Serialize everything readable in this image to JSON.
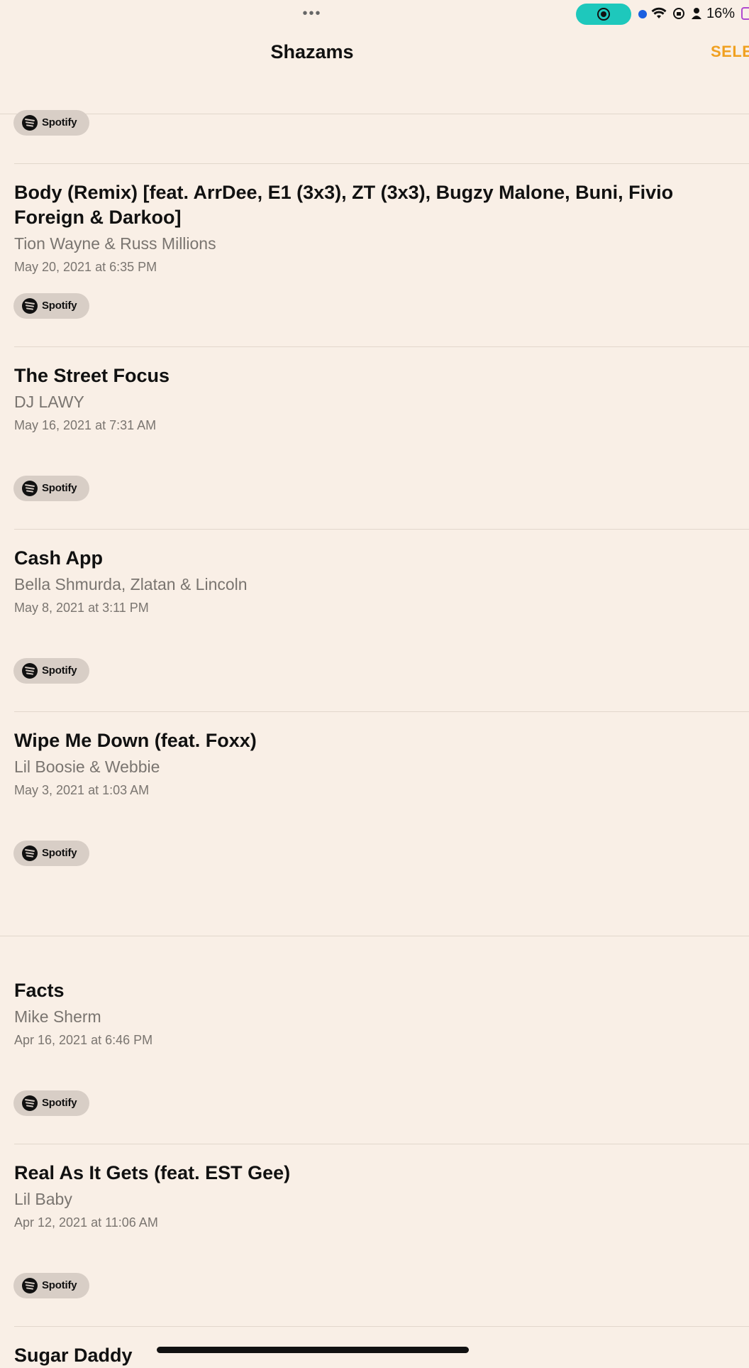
{
  "status_bar": {
    "dots": "•••",
    "battery": "16%"
  },
  "nav": {
    "title": "Shazams",
    "select": "SELE"
  },
  "songs": [
    {
      "title": "Body (Remix) [feat. ArrDee, E1 (3x3), ZT (3x3), Bugzy Malone, Buni, Fivio Foreign & Darkoo]",
      "artist": "Tion Wayne & Russ Millions",
      "date": "May 20, 2021 at 6:35 PM",
      "button": "Spotify"
    },
    {
      "title": "The Street Focus",
      "artist": "DJ LAWY",
      "date": "May 16, 2021 at 7:31 AM",
      "button": "Spotify"
    },
    {
      "title": "Cash App",
      "artist": "Bella Shmurda, Zlatan & Lincoln",
      "date": "May 8, 2021 at 3:11 PM",
      "button": "Spotify"
    },
    {
      "title": "Wipe Me Down (feat. Foxx)",
      "artist": "Lil Boosie & Webbie",
      "date": "May 3, 2021 at 1:03 AM",
      "button": "Spotify"
    },
    {
      "title": "Facts",
      "artist": "Mike Sherm",
      "date": "Apr 16, 2021 at 6:46 PM",
      "button": "Spotify"
    },
    {
      "title": "Real As It Gets (feat. EST Gee)",
      "artist": "Lil Baby",
      "date": "Apr 12, 2021 at 11:06 AM",
      "button": "Spotify"
    },
    {
      "title": "Sugar Daddy"
    }
  ],
  "top_button": "Spotify"
}
